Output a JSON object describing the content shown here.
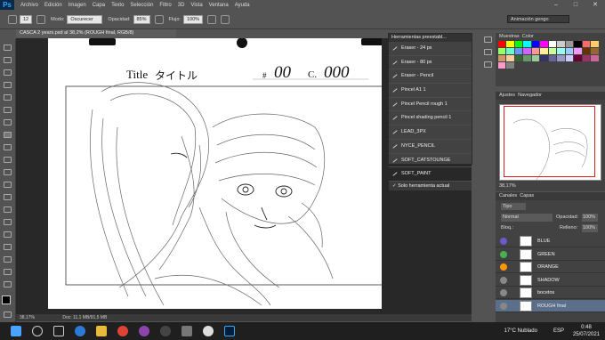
{
  "app": {
    "logo": "Ps"
  },
  "menu": [
    "Archivo",
    "Edición",
    "Imagen",
    "Capa",
    "Texto",
    "Selección",
    "Filtro",
    "3D",
    "Vista",
    "Ventana",
    "Ayuda"
  ],
  "window_controls": [
    "–",
    "□",
    "✕"
  ],
  "options": {
    "size": "12",
    "modo_label": "Modo:",
    "modo_value": "Oscurecer",
    "opacidad_label": "Opacidad:",
    "opacidad_value": "85%",
    "flujo_label": "Flujo:",
    "flujo_value": "100%"
  },
  "workspace": "Animación gengo",
  "doc_tab": "CASCA 2 years.psd al 38,2% (ROUGH final, RGB/8)",
  "sketch": {
    "title_label": "Title",
    "title_jp": "タイトル",
    "num_mark": "#",
    "num_value": "00",
    "c_label": "C.",
    "c_value": "000"
  },
  "status": {
    "zoom": "38,17%",
    "doc": "Doc: 11,1 MB/91,5 MB"
  },
  "presets": {
    "header": "Herramientas preestabl...",
    "items": [
      "Eraser - 24 px",
      "Eraser - 80 px",
      "Eraser - Pencil",
      "Pincel A1 1",
      "Pincel Pencil rough 1",
      "Pincel shading pencil 1",
      "LEAD_3PX",
      "NYCE_PENCIL",
      "SOFT_CATSTOUNGE",
      "SOFT_PAINT"
    ],
    "footer": "Solo herramienta actual"
  },
  "swatches": {
    "tab1": "Muestras",
    "tab2": "Color",
    "colors": [
      "#ff0000",
      "#ffff00",
      "#00ff00",
      "#00ffff",
      "#0000ff",
      "#ff00ff",
      "#ffffff",
      "#cccccc",
      "#999999",
      "#000000",
      "#ff6666",
      "#ffcc66",
      "#99ff66",
      "#66ffcc",
      "#6699ff",
      "#cc66ff",
      "#ff9999",
      "#ffee99",
      "#ccff99",
      "#99ffee",
      "#99ccff",
      "#ee99ff",
      "#663300",
      "#996633",
      "#cc9966",
      "#ffcc99",
      "#336633",
      "#669966",
      "#99cc99",
      "#333366",
      "#666699",
      "#9999cc",
      "#ccccff",
      "#660033",
      "#993366",
      "#cc6699",
      "#ff99cc",
      "#808080"
    ]
  },
  "navigator": {
    "tab1": "Ajustes",
    "tab2": "Navegador",
    "zoom": "38,17%"
  },
  "layers": {
    "tab1": "Canales",
    "tab2": "Capas",
    "kind": "Tipo",
    "blend": "Normal",
    "opacity_label": "Opacidad:",
    "opacity_value": "100%",
    "lock_label": "Bloq.:",
    "fill_label": "Relleno:",
    "fill_value": "100%",
    "rows": [
      {
        "name": "BLUE",
        "color": "#6a5acd"
      },
      {
        "name": "GREEN",
        "color": "#4caf50"
      },
      {
        "name": "ORANGE",
        "color": "#ff9800"
      },
      {
        "name": "SHADOW",
        "color": "#888888"
      },
      {
        "name": "bocetos",
        "color": "#888888"
      },
      {
        "name": "ROUGH final",
        "color": "#888888"
      }
    ]
  },
  "taskbar": {
    "weather": "17°C  Nublado",
    "lang": "ESP",
    "time": "0:48",
    "date": "25/07/2021"
  }
}
